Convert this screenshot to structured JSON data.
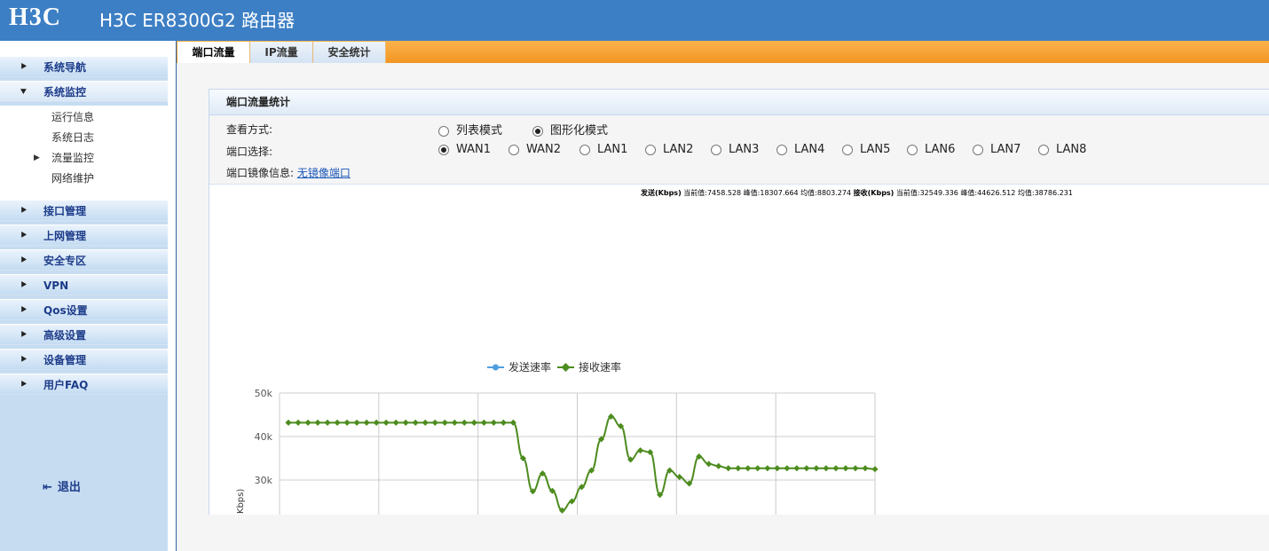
{
  "header": {
    "logo": "H3C",
    "title": "H3C ER8300G2 路由器"
  },
  "sidebar": {
    "menus": [
      {
        "label": "系统导航",
        "icon": "collapsed-arrow-icon"
      },
      {
        "label": "系统监控",
        "icon": "expanded-arrow-icon"
      }
    ],
    "submenu": [
      "运行信息",
      "系统日志",
      "流量监控",
      "网络维护"
    ],
    "active_sub": "流量监控",
    "menus2": [
      "接口管理",
      "上网管理",
      "安全专区",
      "VPN",
      "Qos设置",
      "高级设置",
      "设备管理",
      "用户FAQ"
    ],
    "logout": "退出"
  },
  "tabs": [
    "端口流量",
    "IP流量",
    "安全统计"
  ],
  "active_tab": "端口流量",
  "panel": {
    "title": "端口流量统计",
    "view_label": "查看方式:",
    "view_options": [
      "列表模式",
      "图形化模式"
    ],
    "view_selected": "图形化模式",
    "port_label": "端口选择:",
    "ports": [
      "WAN1",
      "WAN2",
      "LAN1",
      "LAN2",
      "LAN3",
      "LAN4",
      "LAN5",
      "LAN6",
      "LAN7",
      "LAN8"
    ],
    "port_selected": "WAN1",
    "mirror_label": "端口镜像信息:",
    "mirror_link": "无镜像端口"
  },
  "stats": {
    "send_label": "发送(Kbps)",
    "send_values": " 当前值:7458.528 峰值:18307.664 均值:8803.274 ",
    "recv_label": "接收(Kbps)",
    "recv_values": " 当前值:32549.336 峰值:44626.512 均值:38786.231"
  },
  "chart_data": {
    "type": "line",
    "legend": [
      "发送速率",
      "接收速率"
    ],
    "colors": {
      "send": "#4f9fdf",
      "recv": "#4d8c1f"
    },
    "ylabel": "(Kbps)",
    "yticks": [
      "50k",
      "40k",
      "30k"
    ],
    "series": [
      {
        "name": "接收速率",
        "values": [
          43200,
          43200,
          43200,
          43200,
          43200,
          43200,
          43200,
          43200,
          43200,
          43200,
          43200,
          43200,
          43200,
          43200,
          43200,
          43200,
          43200,
          43200,
          43200,
          43200,
          43200,
          43200,
          43200,
          43200,
          35000,
          27400,
          31500,
          27500,
          23000,
          25100,
          28400,
          32200,
          39400,
          44600,
          42400,
          34700,
          36800,
          36400,
          26600,
          32200,
          30700,
          29200,
          35400,
          33700,
          33200,
          32700,
          32700,
          32700,
          32700,
          32700,
          32700,
          32700,
          32700,
          32700,
          32700,
          32700,
          32700,
          32700,
          32700,
          32700,
          32500
        ]
      }
    ]
  }
}
